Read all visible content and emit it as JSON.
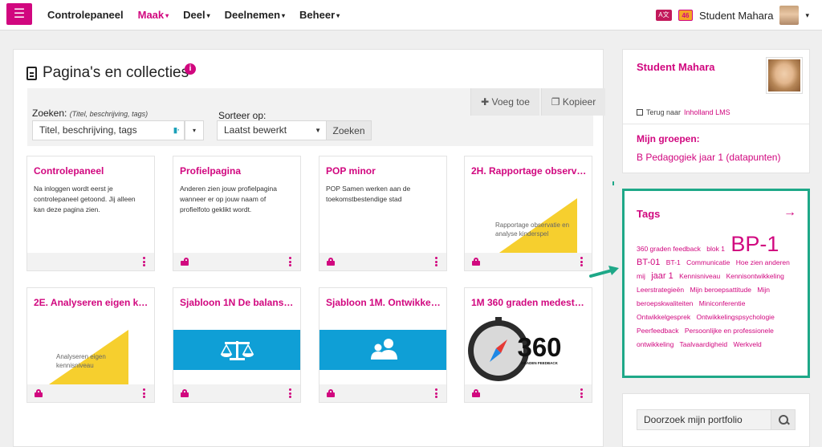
{
  "nav": {
    "menu_icon": "hamburger-icon",
    "items": [
      {
        "label": "Controlepaneel",
        "active": false,
        "dropdown": false
      },
      {
        "label": "Maak",
        "active": true,
        "dropdown": true
      },
      {
        "label": "Deel",
        "active": false,
        "dropdown": true
      },
      {
        "label": "Deelnemen",
        "active": false,
        "dropdown": true
      },
      {
        "label": "Beheer",
        "active": false,
        "dropdown": true
      }
    ],
    "notification_count": "46",
    "user_name": "Student Mahara"
  },
  "main": {
    "title": "Pagina's en collecties",
    "add_button": "Voeg toe",
    "copy_button": "Kopieer",
    "search_label": "Zoeken:",
    "search_hint": "(Titel, beschrijving, tags)",
    "search_value": "Titel, beschrijving, tags",
    "sort_label": "Sorteer op:",
    "sort_value": "Laatst bewerkt",
    "search_button": "Zoeken",
    "cards": [
      {
        "title": "Controlepaneel",
        "desc": "Na inloggen wordt eerst je controlepaneel getoond. Jij alleen kan deze pagina zien.",
        "lock": "none"
      },
      {
        "title": "Profielpagina",
        "desc": "Anderen zien jouw profielpagina wanneer er op jouw naam of profielfoto geklikt wordt.",
        "lock": "open"
      },
      {
        "title": "POP minor",
        "desc": "POP Samen werken aan de toekomstbestendige stad",
        "lock": "closed"
      },
      {
        "title": "2H. Rapportage observa...",
        "thumb_text": "Rapportage observatie en analyse kinderspel",
        "lock": "closed"
      },
      {
        "title": "2E. Analyseren eigen ke...",
        "thumb_text": "Analyseren eigen kennisniveau",
        "lock": "closed"
      },
      {
        "title": "Sjabloon 1N De balans o...",
        "lock": "closed"
      },
      {
        "title": "Sjabloon 1M. Ontwikkel...",
        "lock": "closed"
      },
      {
        "title": "1M 360 graden medestu...",
        "thumb_number": "360",
        "thumb_caption": "GRADEN FEEDBACK",
        "lock": "closed"
      }
    ]
  },
  "sidebar": {
    "profile_name": "Student Mahara",
    "back_text": "Terug naar",
    "back_link": "Inholland LMS",
    "groups_title": "Mijn groepen:",
    "group_item": "B Pedagogiek jaar 1 (datapunten)",
    "tags_title": "Tags",
    "tags": [
      {
        "label": "360 graden feedback",
        "size": "small"
      },
      {
        "label": "blok 1",
        "size": "small"
      },
      {
        "label": "BP-1",
        "size": "big"
      },
      {
        "label": "BT-01",
        "size": "mid"
      },
      {
        "label": "BT-1",
        "size": "small"
      },
      {
        "label": "Communicatie",
        "size": "small"
      },
      {
        "label": "Hoe zien anderen mij",
        "size": "small"
      },
      {
        "label": "jaar 1",
        "size": "mid"
      },
      {
        "label": "Kennisniveau",
        "size": "small"
      },
      {
        "label": "Kennisontwikkeling",
        "size": "small"
      },
      {
        "label": "Leerstrategieën",
        "size": "small"
      },
      {
        "label": "Mijn beroepsattitude",
        "size": "small"
      },
      {
        "label": "Mijn beroepskwaliteiten",
        "size": "small"
      },
      {
        "label": "Miniconferentie",
        "size": "small"
      },
      {
        "label": "Ontwikkelgesprek",
        "size": "small"
      },
      {
        "label": "Ontwikkelingspsychologie",
        "size": "small"
      },
      {
        "label": "Peerfeedback",
        "size": "small"
      },
      {
        "label": "Persoonlijke en professionele ontwikkeling",
        "size": "small"
      },
      {
        "label": "Taalvaardigheid",
        "size": "small"
      },
      {
        "label": "Werkveld",
        "size": "small"
      }
    ],
    "portfolio_search_placeholder": "Doorzoek mijn portfolio"
  },
  "colors": {
    "brand": "#d1077f",
    "highlight": "#1ea888",
    "banner_blue": "#0f9fd6",
    "triangle_yellow": "#f6cf2e"
  }
}
